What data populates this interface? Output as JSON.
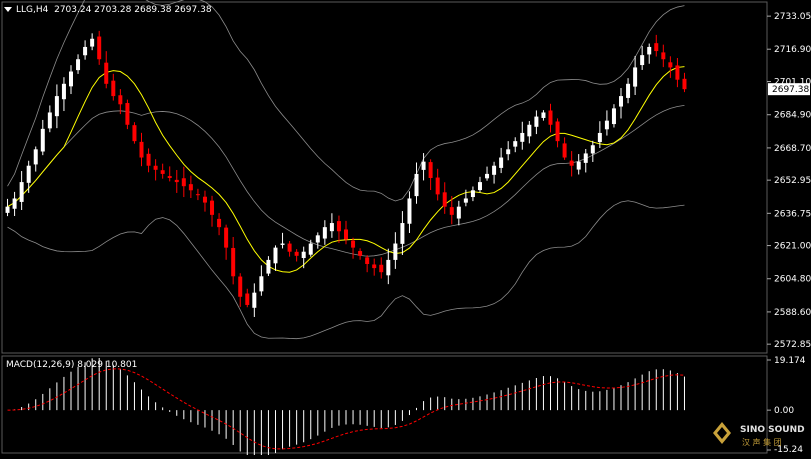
{
  "header": {
    "symbol_label": "LLG,H4",
    "ohlc": "2703.24 2703.28 2689.38 2697.38"
  },
  "price_axis": {
    "ticks": [
      "2733.05",
      "2716.90",
      "2701.10",
      "2684.90",
      "2668.70",
      "2652.95",
      "2636.75",
      "2621.00",
      "2604.80",
      "2588.60",
      "2572.85"
    ],
    "current_price": "2697.38"
  },
  "macd": {
    "label": "MACD(12,26,9) 8.029 10.801",
    "ticks": [
      "19.174",
      "0.00",
      "-15.24"
    ]
  },
  "watermark": {
    "brand": "SINO SOUND",
    "chinese": "汉 声 集 团"
  },
  "colors": {
    "background": "#000000",
    "bull": "#ffffff",
    "bear": "#ff0000",
    "bollinger": "#8c8c8c",
    "ma": "#ffff00",
    "current_price_marker": "#ffffff",
    "macd_hist": "#ffffff",
    "macd_signal": "#ff0000"
  },
  "chart_data": {
    "type": "candlestick",
    "symbol": "LLG",
    "timeframe": "H4",
    "price_range": [
      2570,
      2738
    ],
    "closes_approx": [
      2640,
      2644,
      2652,
      2660,
      2668,
      2678,
      2686,
      2694,
      2700,
      2706,
      2712,
      2718,
      2722,
      2712,
      2700,
      2694,
      2690,
      2680,
      2672,
      2664,
      2660,
      2658,
      2656,
      2654,
      2652,
      2650,
      2648,
      2646,
      2642,
      2636,
      2630,
      2620,
      2606,
      2596,
      2592,
      2598,
      2606,
      2614,
      2620,
      2622,
      2618,
      2616,
      2618,
      2622,
      2626,
      2630,
      2632,
      2628,
      2624,
      2620,
      2616,
      2612,
      2610,
      2608,
      2614,
      2622,
      2632,
      2644,
      2656,
      2662,
      2654,
      2646,
      2640,
      2636,
      2640,
      2644,
      2648,
      2652,
      2656,
      2660,
      2664,
      2668,
      2672,
      2676,
      2680,
      2684,
      2686,
      2680,
      2672,
      2664,
      2660,
      2662,
      2666,
      2670,
      2676,
      2682,
      2688,
      2694,
      2700,
      2708,
      2714,
      2718,
      2716,
      2712,
      2708,
      2702,
      2697.38
    ],
    "macd_value": 8.029,
    "macd_signal": 10.801
  }
}
